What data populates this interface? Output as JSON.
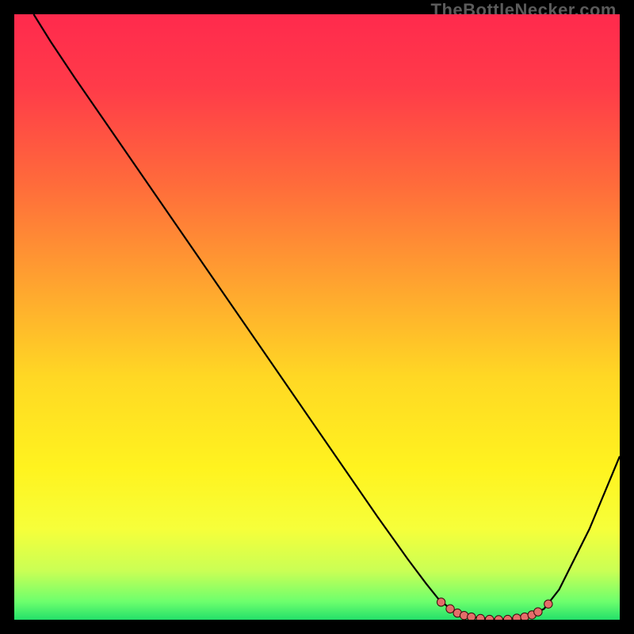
{
  "watermark": "TheBottleNecker.com",
  "chart_data": {
    "type": "line",
    "title": "",
    "xlabel": "",
    "ylabel": "",
    "xlim": [
      0,
      100
    ],
    "ylim": [
      0,
      100
    ],
    "grid": false,
    "legend": false,
    "background_gradient": {
      "stops": [
        {
          "pct": 0,
          "color": "#ff2a4d"
        },
        {
          "pct": 12,
          "color": "#ff3b49"
        },
        {
          "pct": 28,
          "color": "#ff6b3b"
        },
        {
          "pct": 45,
          "color": "#ffa52f"
        },
        {
          "pct": 60,
          "color": "#ffd824"
        },
        {
          "pct": 75,
          "color": "#fff31f"
        },
        {
          "pct": 85,
          "color": "#f6ff3a"
        },
        {
          "pct": 92,
          "color": "#c9ff55"
        },
        {
          "pct": 97,
          "color": "#6dff6d"
        },
        {
          "pct": 100,
          "color": "#24e06a"
        }
      ]
    },
    "curve_points": [
      {
        "x": 3.2,
        "y": 100.0
      },
      {
        "x": 6.0,
        "y": 95.5
      },
      {
        "x": 10.0,
        "y": 89.5
      },
      {
        "x": 20.0,
        "y": 75.0
      },
      {
        "x": 30.0,
        "y": 60.5
      },
      {
        "x": 40.0,
        "y": 46.0
      },
      {
        "x": 50.0,
        "y": 31.5
      },
      {
        "x": 60.0,
        "y": 17.0
      },
      {
        "x": 65.0,
        "y": 10.0
      },
      {
        "x": 68.0,
        "y": 6.0
      },
      {
        "x": 70.0,
        "y": 3.5
      },
      {
        "x": 72.0,
        "y": 1.8
      },
      {
        "x": 75.0,
        "y": 0.5
      },
      {
        "x": 80.0,
        "y": 0.0
      },
      {
        "x": 85.0,
        "y": 0.5
      },
      {
        "x": 87.5,
        "y": 1.8
      },
      {
        "x": 90.0,
        "y": 5.0
      },
      {
        "x": 95.0,
        "y": 15.0
      },
      {
        "x": 100.0,
        "y": 27.0
      }
    ],
    "markers": [
      {
        "x": 70.5,
        "y": 2.9
      },
      {
        "x": 72.0,
        "y": 1.8
      },
      {
        "x": 73.2,
        "y": 1.1
      },
      {
        "x": 74.3,
        "y": 0.7
      },
      {
        "x": 75.5,
        "y": 0.45
      },
      {
        "x": 77.0,
        "y": 0.2
      },
      {
        "x": 78.5,
        "y": 0.05
      },
      {
        "x": 80.0,
        "y": 0.0
      },
      {
        "x": 81.5,
        "y": 0.05
      },
      {
        "x": 83.0,
        "y": 0.25
      },
      {
        "x": 84.3,
        "y": 0.45
      },
      {
        "x": 85.5,
        "y": 0.8
      },
      {
        "x": 86.5,
        "y": 1.3
      },
      {
        "x": 88.2,
        "y": 2.6
      }
    ],
    "marker_color": "#e46d6a",
    "marker_edge": "#3a0a0a",
    "curve_color": "#000000"
  }
}
